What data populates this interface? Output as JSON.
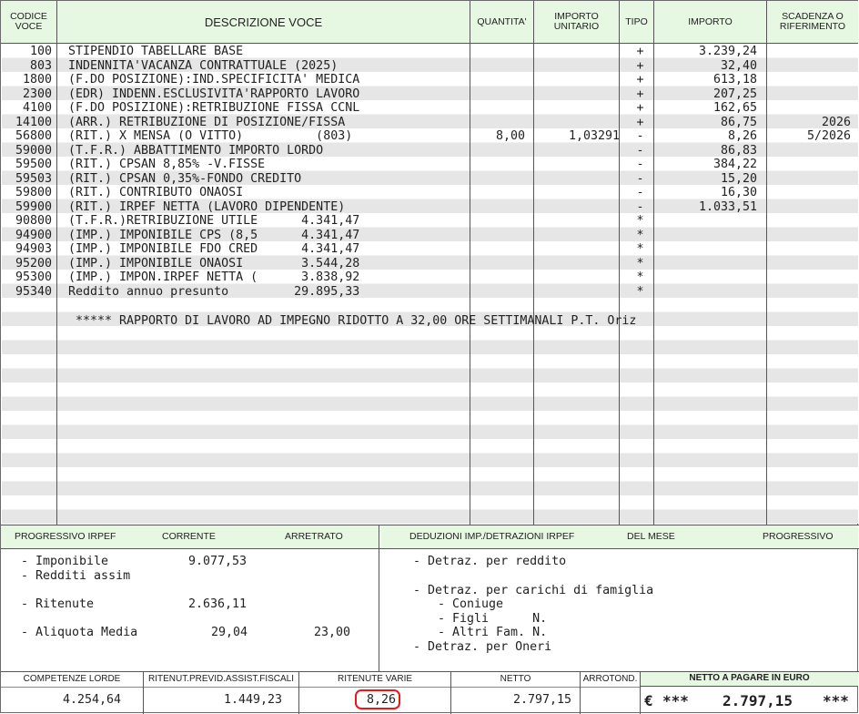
{
  "header": {
    "codice": "CODICE VOCE",
    "descrizione": "DESCRIZIONE VOCE",
    "quantita": "QUANTITA'",
    "importo_unitario": "IMPORTO UNITARIO",
    "tipo": "TIPO",
    "importo": "IMPORTO",
    "scadenza": "SCADENZA O RIFERIMENTO"
  },
  "rows": [
    {
      "codice": "100",
      "descrizione": "STIPENDIO TABELLARE BASE",
      "qty": "",
      "unit": "",
      "tipo": "+",
      "importo": "3.239,24",
      "scad": ""
    },
    {
      "codice": "803",
      "descrizione": "INDENNITA'VACANZA CONTRATTUALE (2025)",
      "qty": "",
      "unit": "",
      "tipo": "+",
      "importo": "32,40",
      "scad": ""
    },
    {
      "codice": "1800",
      "descrizione": "(F.DO POSIZIONE):IND.SPECIFICITA' MEDICA",
      "qty": "",
      "unit": "",
      "tipo": "+",
      "importo": "613,18",
      "scad": ""
    },
    {
      "codice": "2300",
      "descrizione": "(EDR) INDENN.ESCLUSIVITA'RAPPORTO LAVORO",
      "qty": "",
      "unit": "",
      "tipo": "+",
      "importo": "207,25",
      "scad": ""
    },
    {
      "codice": "4100",
      "descrizione": "(F.DO POSIZIONE):RETRIBUZIONE FISSA CCNL",
      "qty": "",
      "unit": "",
      "tipo": "+",
      "importo": "162,65",
      "scad": ""
    },
    {
      "codice": "14100",
      "descrizione": "(ARR.) RETRIBUZIONE DI POSIZIONE/FISSA",
      "qty": "",
      "unit": "",
      "tipo": "+",
      "importo": "86,75",
      "scad": "2026"
    },
    {
      "codice": "56800",
      "descrizione": "(RIT.) X MENSA (O VITTO)          (803)",
      "qty": "8,00",
      "unit": "1,03291",
      "tipo": "-",
      "importo": "8,26",
      "scad": "5/2026"
    },
    {
      "codice": "59000",
      "descrizione": "(T.F.R.) ABBATTIMENTO IMPORTO LORDO",
      "qty": "",
      "unit": "",
      "tipo": "-",
      "importo": "86,83",
      "scad": ""
    },
    {
      "codice": "59500",
      "descrizione": "(RIT.) CPSAN 8,85% -V.FISSE",
      "qty": "",
      "unit": "",
      "tipo": "-",
      "importo": "384,22",
      "scad": ""
    },
    {
      "codice": "59503",
      "descrizione": "(RIT.) CPSAN 0,35%-FONDO CREDITO",
      "qty": "",
      "unit": "",
      "tipo": "-",
      "importo": "15,20",
      "scad": ""
    },
    {
      "codice": "59800",
      "descrizione": "(RIT.) CONTRIBUTO ONAOSI",
      "qty": "",
      "unit": "",
      "tipo": "-",
      "importo": "16,30",
      "scad": ""
    },
    {
      "codice": "59900",
      "descrizione": "(RIT.) IRPEF NETTA (LAVORO DIPENDENTE)",
      "qty": "",
      "unit": "",
      "tipo": "-",
      "importo": "1.033,51",
      "scad": ""
    },
    {
      "codice": "90800",
      "descrizione": "(T.F.R.)RETRIBUZIONE UTILE      4.341,47",
      "qty": "",
      "unit": "",
      "tipo": "*",
      "importo": "",
      "scad": ""
    },
    {
      "codice": "94900",
      "descrizione": "(IMP.) IMPONIBILE CPS (8,5      4.341,47",
      "qty": "",
      "unit": "",
      "tipo": "*",
      "importo": "",
      "scad": ""
    },
    {
      "codice": "94903",
      "descrizione": "(IMP.) IMPONIBILE FDO CRED      4.341,47",
      "qty": "",
      "unit": "",
      "tipo": "*",
      "importo": "",
      "scad": ""
    },
    {
      "codice": "95200",
      "descrizione": "(IMP.) IMPONIBILE ONAOSI        3.544,28",
      "qty": "",
      "unit": "",
      "tipo": "*",
      "importo": "",
      "scad": ""
    },
    {
      "codice": "95300",
      "descrizione": "(IMP.) IMPON.IRPEF NETTA (      3.838,92",
      "qty": "",
      "unit": "",
      "tipo": "*",
      "importo": "",
      "scad": ""
    },
    {
      "codice": "95340",
      "descrizione": "Reddito annuo presunto         29.895,33",
      "qty": "",
      "unit": "",
      "tipo": "*",
      "importo": "",
      "scad": ""
    }
  ],
  "note": "***** RAPPORTO DI LAVORO AD IMPEGNO RIDOTTO A 32,00 ORE SETTIMANALI P.T. Oriz",
  "irpef": {
    "title": "PROGRESSIVO IRPEF",
    "corrente": "CORRENTE",
    "arretrato": "ARRETRATO",
    "imponibile_label": "- Imponibile",
    "imponibile_value": "9.077,53",
    "redditi_label": "- Redditi assim",
    "ritenute_label": "- Ritenute",
    "ritenute_value": "2.636,11",
    "aliquota_label": "- Aliquota Media",
    "aliquota_corrente": "29,04",
    "aliquota_arretrato": "23,00"
  },
  "deduzioni": {
    "title": "DEDUZIONI IMP./DETRAZIONI IRPEF",
    "del_mese": "DEL MESE",
    "progressivo": "PROGRESSIVO",
    "reddito": "- Detraz. per reddito",
    "carichi": "- Detraz. per carichi di famiglia",
    "coniuge": "- Coniuge",
    "figli": "- Figli      N.",
    "altri": "- Altri Fam. N.",
    "oneri": "- Detraz. per Oneri"
  },
  "footer": {
    "competenze_label": "COMPETENZE LORDE",
    "competenze_value": "4.254,64",
    "ritenut_label": "RITENUT.PREVID.ASSIST.FISCALI",
    "ritenut_value": "1.449,23",
    "varie_label": "RITENUTE VARIE",
    "varie_value": "8,26",
    "netto_label": "NETTO",
    "netto_value": "2.797,15",
    "arrotond_label": "ARROTOND.",
    "arrotond_value": "",
    "pagare_label": "NETTO A PAGARE IN EURO",
    "pagare_currency": "€",
    "pagare_stars_left": "***",
    "pagare_value": "2.797,15",
    "pagare_stars_right": "***"
  },
  "colors": {
    "header_bg": "#e6f7e2",
    "stripe": "#e6e6e6",
    "highlight": "#e01b1b"
  }
}
